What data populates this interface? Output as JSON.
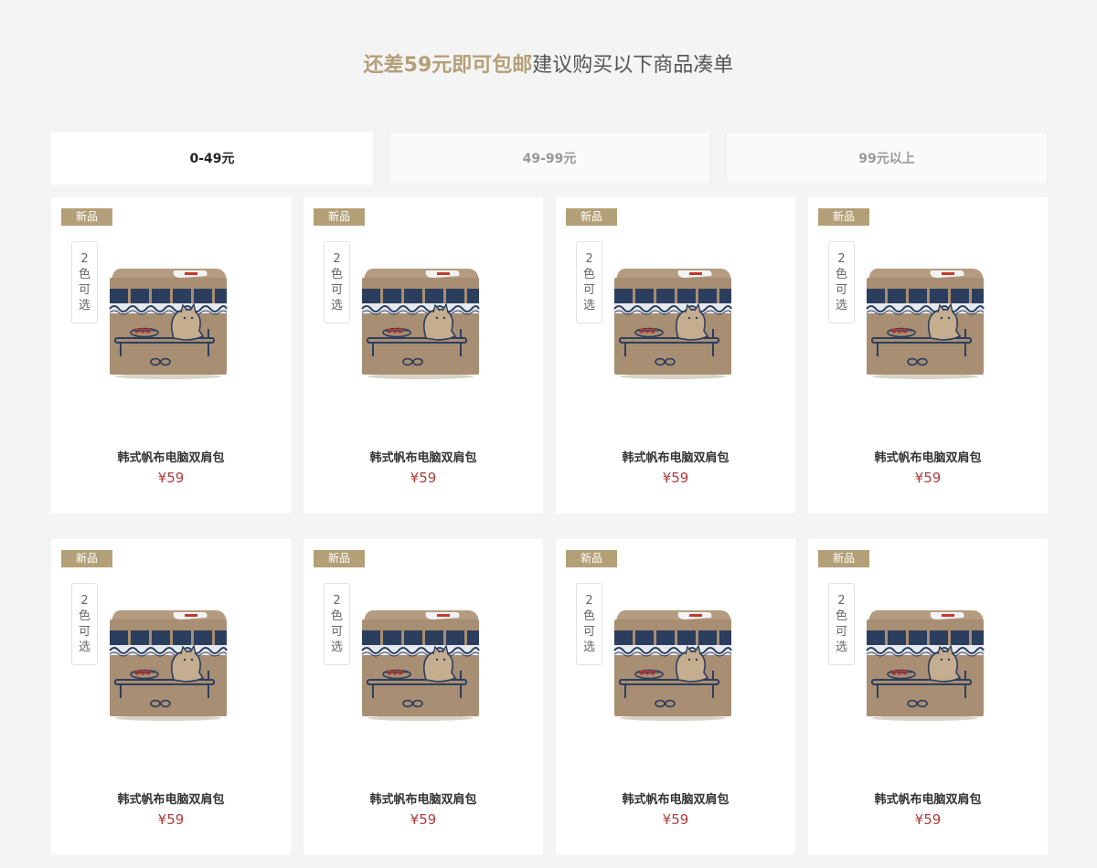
{
  "header": {
    "accent_text": "还差59元即可包邮",
    "rest_text": "建议购买以下商品凑单"
  },
  "tabs": [
    {
      "label": "0-49元",
      "active": true
    },
    {
      "label": "49-99元",
      "active": false
    },
    {
      "label": "99元以上",
      "active": false
    }
  ],
  "products": [
    {
      "badge": "新品",
      "color_options": [
        "2",
        "色",
        "可",
        "选"
      ],
      "name": "韩式帆布电脑双肩包",
      "price": "¥59"
    },
    {
      "badge": "新品",
      "color_options": [
        "2",
        "色",
        "可",
        "选"
      ],
      "name": "韩式帆布电脑双肩包",
      "price": "¥59"
    },
    {
      "badge": "新品",
      "color_options": [
        "2",
        "色",
        "可",
        "选"
      ],
      "name": "韩式帆布电脑双肩包",
      "price": "¥59"
    },
    {
      "badge": "新品",
      "color_options": [
        "2",
        "色",
        "可",
        "选"
      ],
      "name": "韩式帆布电脑双肩包",
      "price": "¥59"
    },
    {
      "badge": "新品",
      "color_options": [
        "2",
        "色",
        "可",
        "选"
      ],
      "name": "韩式帆布电脑双肩包",
      "price": "¥59"
    },
    {
      "badge": "新品",
      "color_options": [
        "2",
        "色",
        "可",
        "选"
      ],
      "name": "韩式帆布电脑双肩包",
      "price": "¥59"
    },
    {
      "badge": "新品",
      "color_options": [
        "2",
        "色",
        "可",
        "选"
      ],
      "name": "韩式帆布电脑双肩包",
      "price": "¥59"
    },
    {
      "badge": "新品",
      "color_options": [
        "2",
        "色",
        "可",
        "选"
      ],
      "name": "韩式帆布电脑双肩包",
      "price": "¥59"
    }
  ],
  "colors": {
    "accent": "#b4a078",
    "price": "#b03a3a",
    "background": "#f4f4f4",
    "box_kraft": "#a88e72",
    "box_navy": "#2c3e5e"
  },
  "icons": {
    "product_image": "kraft-box-cat-illustration"
  }
}
